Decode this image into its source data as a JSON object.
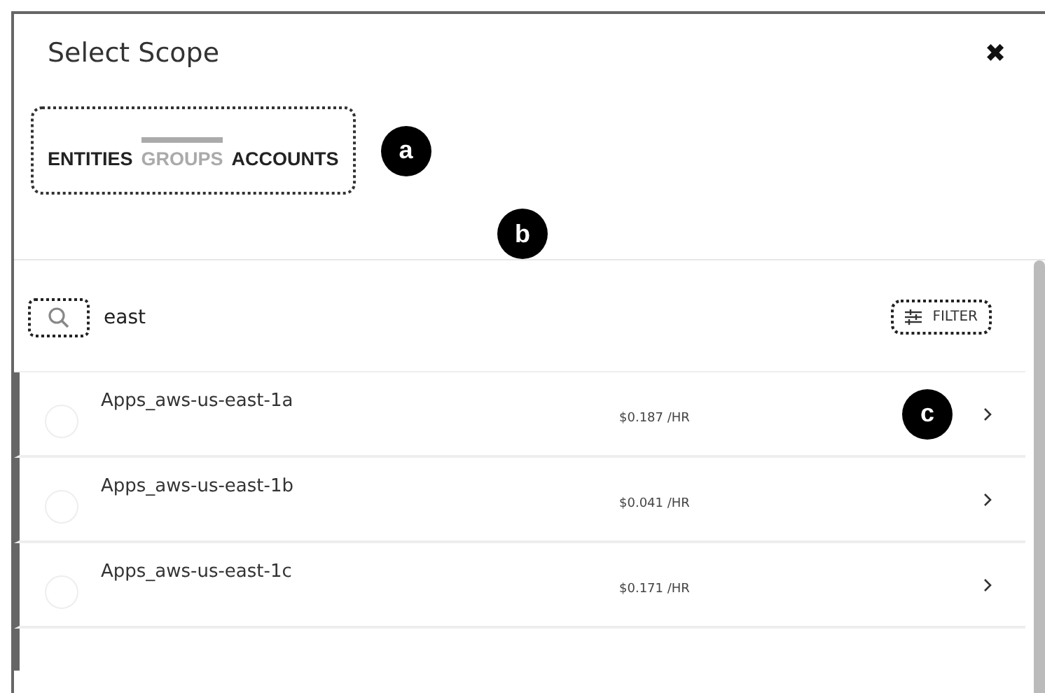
{
  "dialog": {
    "title": "Select Scope",
    "close": "✖"
  },
  "tabs": [
    {
      "label": "ENTITIES",
      "selected": false
    },
    {
      "label": "GROUPS",
      "selected": true
    },
    {
      "label": "ACCOUNTS",
      "selected": false
    }
  ],
  "callouts": [
    "a",
    "b",
    "c"
  ],
  "search": {
    "value": "east"
  },
  "filter_button": "FILTER",
  "rows": [
    {
      "name": "Apps_aws-us-east-1a",
      "cost": "$0.187 /HR",
      "checked": false
    },
    {
      "name": "Apps_aws-us-east-1b",
      "cost": "$0.041 /HR",
      "checked": false
    },
    {
      "name": "Apps_aws-us-east-1c",
      "cost": "$0.171 /HR",
      "checked": false
    }
  ]
}
